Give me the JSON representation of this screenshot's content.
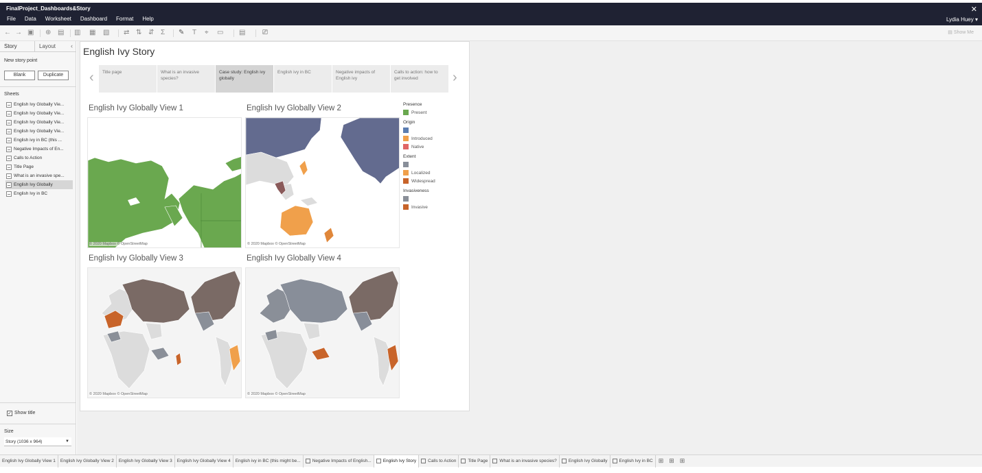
{
  "window": {
    "title": "FinalProject_Dashboards&Story",
    "close": "✕",
    "user": "Lydia Huey ▾",
    "menu": [
      "File",
      "Data",
      "Worksheet",
      "Dashboard",
      "Format",
      "Help"
    ]
  },
  "toolbar": {
    "show_me": "Show Me"
  },
  "left": {
    "tabs": {
      "story": "Story",
      "layout": "Layout",
      "collapse": "‹"
    },
    "new_story_point": "New story point",
    "blank": "Blank",
    "duplicate": "Duplicate",
    "sheets_header": "Sheets",
    "sheets": [
      "English Ivy Globally Vie...",
      "English Ivy Globally Vie...",
      "English Ivy Globally Vie...",
      "English Ivy Globally Vie...",
      "English ivy in BC (this ...",
      "Negative Impacts of En...",
      "Calls to Action",
      "Title Page",
      "What is an invasive spe...",
      "English Ivy Globally",
      "English Ivy in BC"
    ],
    "selected_sheet": "English Ivy Globally",
    "show_title": "Show title",
    "size_label": "Size",
    "size_value": "Story (1036 x 964)"
  },
  "story": {
    "title": "English Ivy Story",
    "points": [
      "Title page",
      "What is an invasive species?",
      "Case study: English ivy globally",
      "English ivy in BC",
      "Negative impacts of English ivy",
      "Calls to action: how to get involved"
    ],
    "current_point": "Case study: English ivy globally",
    "views": [
      {
        "title": "English Ivy Globally View 1",
        "credit": "© 2020 Mapbox © OpenStreetMap"
      },
      {
        "title": "English Ivy Globally View 2",
        "credit": "© 2020 Mapbox © OpenStreetMap"
      },
      {
        "title": "English Ivy Globally View 3",
        "credit": "© 2020 Mapbox © OpenStreetMap"
      },
      {
        "title": "English Ivy Globally View 4",
        "credit": "© 2020 Mapbox © OpenStreetMap"
      }
    ]
  },
  "legend": {
    "presence": {
      "title": "Presence",
      "items": [
        {
          "label": "Present",
          "color": "#6aa84f"
        }
      ]
    },
    "origin": {
      "title": "Origin",
      "items": [
        {
          "label": "",
          "color": "#5b7db1"
        },
        {
          "label": "Introduced",
          "color": "#f0a04b"
        },
        {
          "label": "Native",
          "color": "#e06666"
        }
      ]
    },
    "extent": {
      "title": "Extent",
      "items": [
        {
          "label": "",
          "color": "#888e99"
        },
        {
          "label": "Localized",
          "color": "#f0a04b"
        },
        {
          "label": "Widespread",
          "color": "#c8642a"
        }
      ]
    },
    "invasiveness": {
      "title": "Invasiveness",
      "items": [
        {
          "label": "",
          "color": "#8a8f98"
        },
        {
          "label": "Invasive",
          "color": "#c8642a"
        }
      ]
    }
  },
  "bottom_tabs": [
    "English Ivy Globally View 1",
    "English Ivy Globally View 2",
    "English Ivy Globally View 3",
    "English Ivy Globally View 4",
    "English ivy in BC (this might be...",
    "Negative Impacts of English...",
    "English Ivy Story",
    "Calls to Action",
    "Title Page",
    "What is an invasive species?",
    "English Ivy Globally",
    "English Ivy in BC"
  ],
  "active_bottom_tab": "English Ivy Story"
}
